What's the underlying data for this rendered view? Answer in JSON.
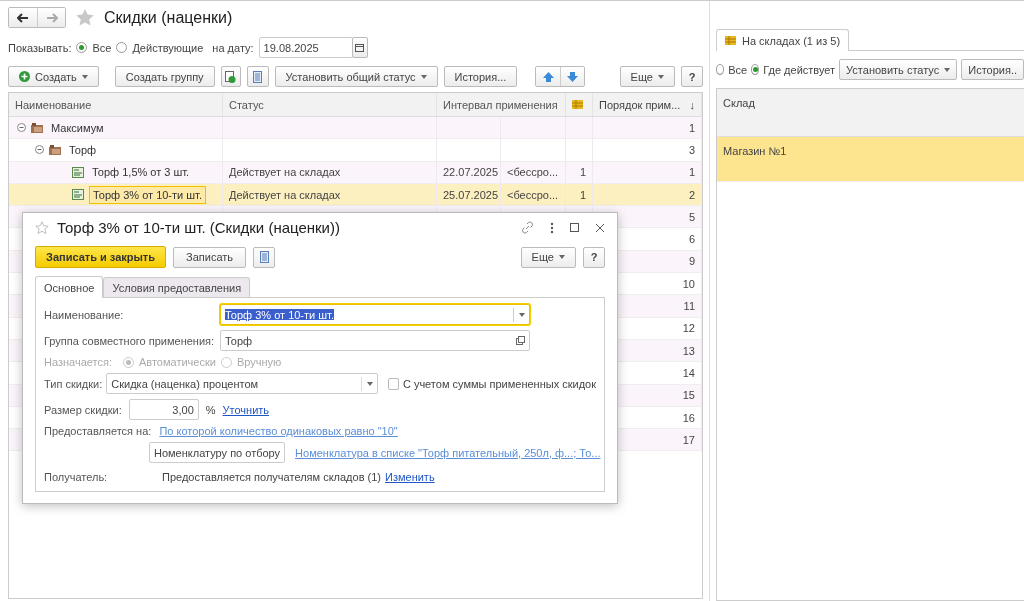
{
  "window": {
    "title": "Скидки (наценки)"
  },
  "filter": {
    "label": "Показывать:",
    "options": [
      {
        "label": "Все",
        "selected": true
      },
      {
        "label": "Действующие",
        "selected": false
      }
    ],
    "date_label": "на дату:",
    "date": "19.08.2025"
  },
  "toolbar": {
    "create": "Создать",
    "create_group": "Создать группу",
    "set_status": "Установить общий статус",
    "history": "История...",
    "more": "Еще",
    "help": "?"
  },
  "table": {
    "columns": [
      "Наименование",
      "Статус",
      "Интервал применения",
      "Порядок прим..."
    ],
    "sort_mark": "↓",
    "rows": [
      {
        "kind": "group",
        "name": "Максимум",
        "expanded": true,
        "order": "1",
        "children": [
          {
            "kind": "group",
            "name": "Торф",
            "expanded": true,
            "order": "3",
            "children": [
              {
                "kind": "item",
                "name": "Торф 1,5% от 3 шт.",
                "status": "Действует на складах",
                "start": "22.07.2025",
                "end": "<бессро...",
                "count": "1",
                "order": "1",
                "selected": false
              },
              {
                "kind": "item",
                "name": "Торф 3% от 10-ти шт.",
                "status": "Действует на складах",
                "start": "25.07.2025",
                "end": "<бессро...",
                "count": "1",
                "order": "2",
                "selected": true
              }
            ]
          }
        ]
      },
      {
        "kind": "covered",
        "order": "5"
      },
      {
        "kind": "covered",
        "order": "6"
      },
      {
        "kind": "covered",
        "order": "9"
      },
      {
        "kind": "covered",
        "order": "10"
      },
      {
        "kind": "covered",
        "order": "11"
      },
      {
        "kind": "covered",
        "order": "12"
      },
      {
        "kind": "covered",
        "order": "13"
      },
      {
        "kind": "covered",
        "order": "14"
      },
      {
        "kind": "covered",
        "order": "15"
      },
      {
        "kind": "covered",
        "order": "16"
      },
      {
        "kind": "covered",
        "order": "17"
      }
    ]
  },
  "side_panel": {
    "tab": "На складах (1 из 5)",
    "options": [
      {
        "label": "Все",
        "selected": false
      },
      {
        "label": "Где действует",
        "selected": true
      }
    ],
    "set_status": "Установить статус",
    "history": "История..",
    "column": "Склад",
    "rows": [
      {
        "name": "Магазин №1",
        "selected": true
      }
    ]
  },
  "dialog": {
    "title": "Торф 3% от 10-ти шт. (Скидки (наценки))",
    "save_close": "Записать и закрыть",
    "save": "Записать",
    "more": "Еще",
    "help": "?",
    "tabs": [
      {
        "label": "Основное",
        "selected": true
      },
      {
        "label": "Условия предоставления",
        "selected": false
      }
    ],
    "name_label": "Наименование:",
    "name": "Торф 3% от 10-ти шт.",
    "group_label": "Группа совместного применения:",
    "group": "Торф",
    "assign_label": "Назначается:",
    "assign_options": [
      {
        "label": "Автоматически",
        "selected": true
      },
      {
        "label": "Вручную",
        "selected": false
      }
    ],
    "type_label": "Тип скидки:",
    "type": "Скидка (наценка) процентом",
    "consider_label": "С учетом суммы примененных скидок",
    "consider": false,
    "size_label": "Размер скидки:",
    "size": "3,00",
    "unit": "%",
    "refine": "Уточнить",
    "provided_label": "Предоставляется на:",
    "provided_link": "По которой количество одинаковых равно \"10\"",
    "nomenclature": "Номенклатуру по отбору",
    "nomenclature_link": "Номенклатура в списке \"Торф питательный, 250л, ф...; То...",
    "recipient_label": "Получатель:",
    "recipient": "Предоставляется получателям складов (1)",
    "change": "Изменить"
  }
}
